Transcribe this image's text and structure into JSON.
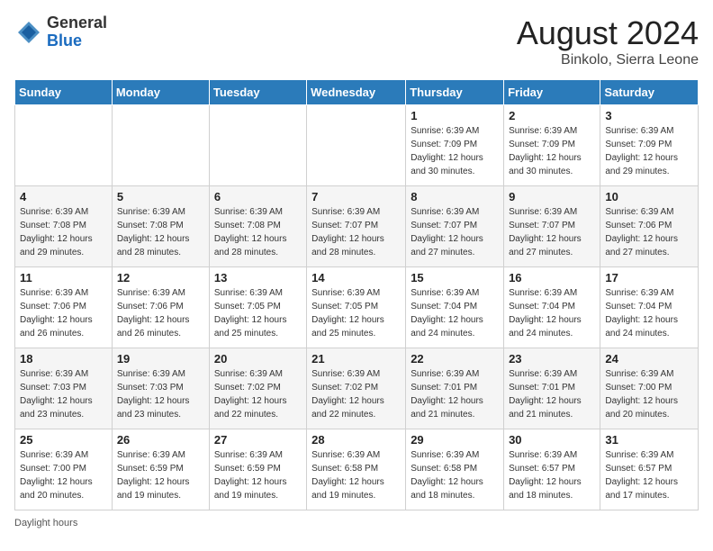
{
  "header": {
    "logo_general": "General",
    "logo_blue": "Blue",
    "month_year": "August 2024",
    "location": "Binkolo, Sierra Leone"
  },
  "columns": [
    "Sunday",
    "Monday",
    "Tuesday",
    "Wednesday",
    "Thursday",
    "Friday",
    "Saturday"
  ],
  "weeks": [
    [
      {
        "day": "",
        "sunrise": "",
        "sunset": "",
        "daylight": ""
      },
      {
        "day": "",
        "sunrise": "",
        "sunset": "",
        "daylight": ""
      },
      {
        "day": "",
        "sunrise": "",
        "sunset": "",
        "daylight": ""
      },
      {
        "day": "",
        "sunrise": "",
        "sunset": "",
        "daylight": ""
      },
      {
        "day": "1",
        "sunrise": "Sunrise: 6:39 AM",
        "sunset": "Sunset: 7:09 PM",
        "daylight": "Daylight: 12 hours and 30 minutes."
      },
      {
        "day": "2",
        "sunrise": "Sunrise: 6:39 AM",
        "sunset": "Sunset: 7:09 PM",
        "daylight": "Daylight: 12 hours and 30 minutes."
      },
      {
        "day": "3",
        "sunrise": "Sunrise: 6:39 AM",
        "sunset": "Sunset: 7:09 PM",
        "daylight": "Daylight: 12 hours and 29 minutes."
      }
    ],
    [
      {
        "day": "4",
        "sunrise": "Sunrise: 6:39 AM",
        "sunset": "Sunset: 7:08 PM",
        "daylight": "Daylight: 12 hours and 29 minutes."
      },
      {
        "day": "5",
        "sunrise": "Sunrise: 6:39 AM",
        "sunset": "Sunset: 7:08 PM",
        "daylight": "Daylight: 12 hours and 28 minutes."
      },
      {
        "day": "6",
        "sunrise": "Sunrise: 6:39 AM",
        "sunset": "Sunset: 7:08 PM",
        "daylight": "Daylight: 12 hours and 28 minutes."
      },
      {
        "day": "7",
        "sunrise": "Sunrise: 6:39 AM",
        "sunset": "Sunset: 7:07 PM",
        "daylight": "Daylight: 12 hours and 28 minutes."
      },
      {
        "day": "8",
        "sunrise": "Sunrise: 6:39 AM",
        "sunset": "Sunset: 7:07 PM",
        "daylight": "Daylight: 12 hours and 27 minutes."
      },
      {
        "day": "9",
        "sunrise": "Sunrise: 6:39 AM",
        "sunset": "Sunset: 7:07 PM",
        "daylight": "Daylight: 12 hours and 27 minutes."
      },
      {
        "day": "10",
        "sunrise": "Sunrise: 6:39 AM",
        "sunset": "Sunset: 7:06 PM",
        "daylight": "Daylight: 12 hours and 27 minutes."
      }
    ],
    [
      {
        "day": "11",
        "sunrise": "Sunrise: 6:39 AM",
        "sunset": "Sunset: 7:06 PM",
        "daylight": "Daylight: 12 hours and 26 minutes."
      },
      {
        "day": "12",
        "sunrise": "Sunrise: 6:39 AM",
        "sunset": "Sunset: 7:06 PM",
        "daylight": "Daylight: 12 hours and 26 minutes."
      },
      {
        "day": "13",
        "sunrise": "Sunrise: 6:39 AM",
        "sunset": "Sunset: 7:05 PM",
        "daylight": "Daylight: 12 hours and 25 minutes."
      },
      {
        "day": "14",
        "sunrise": "Sunrise: 6:39 AM",
        "sunset": "Sunset: 7:05 PM",
        "daylight": "Daylight: 12 hours and 25 minutes."
      },
      {
        "day": "15",
        "sunrise": "Sunrise: 6:39 AM",
        "sunset": "Sunset: 7:04 PM",
        "daylight": "Daylight: 12 hours and 24 minutes."
      },
      {
        "day": "16",
        "sunrise": "Sunrise: 6:39 AM",
        "sunset": "Sunset: 7:04 PM",
        "daylight": "Daylight: 12 hours and 24 minutes."
      },
      {
        "day": "17",
        "sunrise": "Sunrise: 6:39 AM",
        "sunset": "Sunset: 7:04 PM",
        "daylight": "Daylight: 12 hours and 24 minutes."
      }
    ],
    [
      {
        "day": "18",
        "sunrise": "Sunrise: 6:39 AM",
        "sunset": "Sunset: 7:03 PM",
        "daylight": "Daylight: 12 hours and 23 minutes."
      },
      {
        "day": "19",
        "sunrise": "Sunrise: 6:39 AM",
        "sunset": "Sunset: 7:03 PM",
        "daylight": "Daylight: 12 hours and 23 minutes."
      },
      {
        "day": "20",
        "sunrise": "Sunrise: 6:39 AM",
        "sunset": "Sunset: 7:02 PM",
        "daylight": "Daylight: 12 hours and 22 minutes."
      },
      {
        "day": "21",
        "sunrise": "Sunrise: 6:39 AM",
        "sunset": "Sunset: 7:02 PM",
        "daylight": "Daylight: 12 hours and 22 minutes."
      },
      {
        "day": "22",
        "sunrise": "Sunrise: 6:39 AM",
        "sunset": "Sunset: 7:01 PM",
        "daylight": "Daylight: 12 hours and 21 minutes."
      },
      {
        "day": "23",
        "sunrise": "Sunrise: 6:39 AM",
        "sunset": "Sunset: 7:01 PM",
        "daylight": "Daylight: 12 hours and 21 minutes."
      },
      {
        "day": "24",
        "sunrise": "Sunrise: 6:39 AM",
        "sunset": "Sunset: 7:00 PM",
        "daylight": "Daylight: 12 hours and 20 minutes."
      }
    ],
    [
      {
        "day": "25",
        "sunrise": "Sunrise: 6:39 AM",
        "sunset": "Sunset: 7:00 PM",
        "daylight": "Daylight: 12 hours and 20 minutes."
      },
      {
        "day": "26",
        "sunrise": "Sunrise: 6:39 AM",
        "sunset": "Sunset: 6:59 PM",
        "daylight": "Daylight: 12 hours and 19 minutes."
      },
      {
        "day": "27",
        "sunrise": "Sunrise: 6:39 AM",
        "sunset": "Sunset: 6:59 PM",
        "daylight": "Daylight: 12 hours and 19 minutes."
      },
      {
        "day": "28",
        "sunrise": "Sunrise: 6:39 AM",
        "sunset": "Sunset: 6:58 PM",
        "daylight": "Daylight: 12 hours and 19 minutes."
      },
      {
        "day": "29",
        "sunrise": "Sunrise: 6:39 AM",
        "sunset": "Sunset: 6:58 PM",
        "daylight": "Daylight: 12 hours and 18 minutes."
      },
      {
        "day": "30",
        "sunrise": "Sunrise: 6:39 AM",
        "sunset": "Sunset: 6:57 PM",
        "daylight": "Daylight: 12 hours and 18 minutes."
      },
      {
        "day": "31",
        "sunrise": "Sunrise: 6:39 AM",
        "sunset": "Sunset: 6:57 PM",
        "daylight": "Daylight: 12 hours and 17 minutes."
      }
    ]
  ],
  "footer": {
    "daylight_hours_label": "Daylight hours"
  }
}
